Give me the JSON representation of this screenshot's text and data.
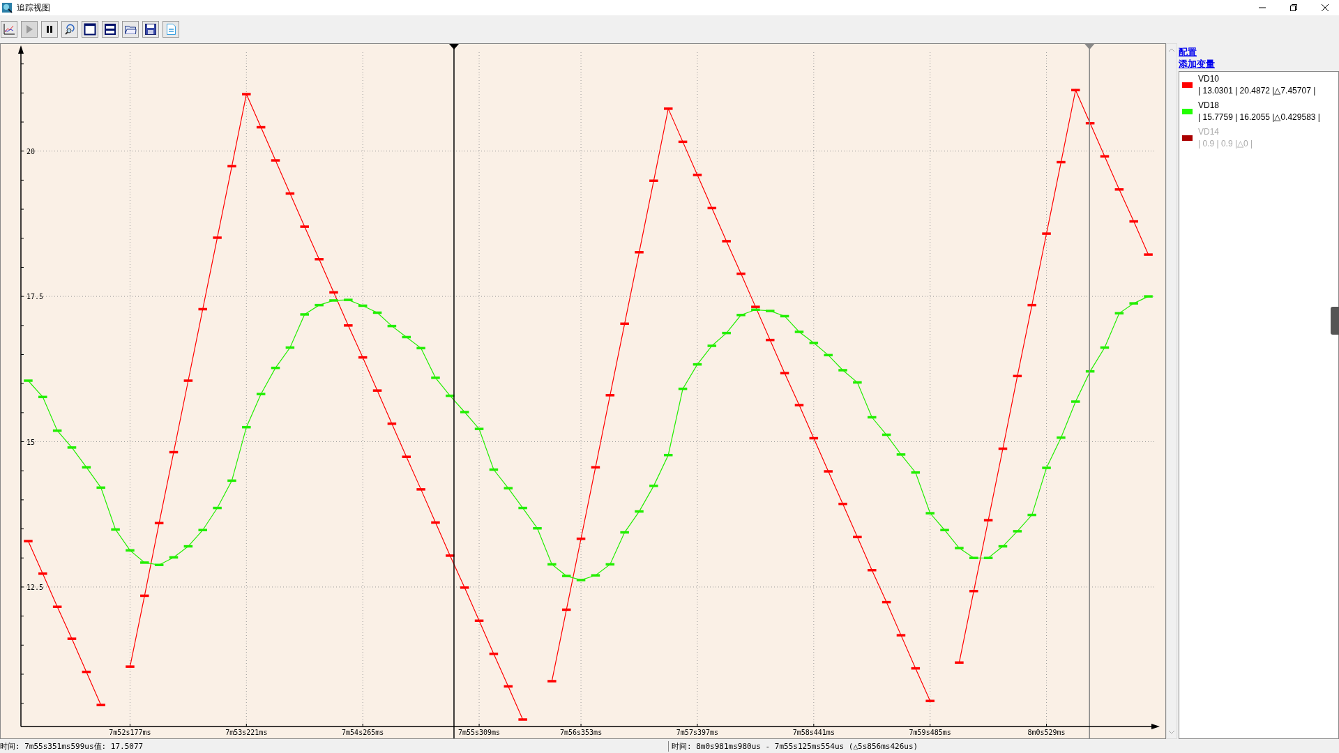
{
  "window": {
    "title": "追踪视图"
  },
  "toolbar": [
    {
      "kind": "chart"
    },
    {
      "kind": "play",
      "disabled": true
    },
    {
      "kind": "pause"
    },
    {
      "kind": "zoom"
    },
    {
      "kind": "window"
    },
    {
      "kind": "split"
    },
    {
      "kind": "open"
    },
    {
      "kind": "save"
    },
    {
      "kind": "csv"
    }
  ],
  "chart": {
    "chart_data": {
      "type": "line",
      "categories": [
        null,
        null,
        null,
        null,
        null,
        null,
        null,
        "7m52s177ms",
        null,
        null,
        null,
        null,
        null,
        null,
        null,
        "7m53s221ms",
        null,
        null,
        null,
        null,
        null,
        null,
        null,
        "7m54s265ms",
        null,
        null,
        null,
        null,
        null,
        null,
        null,
        "7m55s309ms",
        null,
        null,
        null,
        null,
        null,
        null,
        "7m56s353ms",
        null,
        null,
        null,
        null,
        null,
        null,
        null,
        "7m57s397ms",
        null,
        null,
        null,
        null,
        null,
        null,
        null,
        "7m58s441ms",
        null,
        null,
        null,
        null,
        null,
        null,
        null,
        "7m59s485ms",
        null,
        null,
        null,
        null,
        null,
        null,
        null,
        "8m0s529ms",
        null,
        null,
        null,
        null,
        null,
        null,
        null
      ],
      "ylim": [
        10.1,
        21.7
      ],
      "grid": true,
      "yticks": [
        {
          "value": 12.5,
          "label": "12.5"
        },
        {
          "value": 15,
          "label": "15"
        },
        {
          "value": 17.5,
          "label": "17.5"
        },
        {
          "value": 20,
          "label": "20"
        }
      ],
      "series": [
        {
          "color": "#ff0000",
          "values": [
            13.29,
            12.73,
            12.16,
            11.61,
            11.04,
            10.47,
            null,
            11.13,
            12.35,
            13.6,
            14.82,
            16.05,
            17.28,
            18.51,
            19.74,
            20.98,
            20.41,
            19.84,
            19.27,
            18.7,
            18.14,
            17.57,
            17.0,
            16.45,
            15.88,
            15.31,
            14.74,
            14.18,
            13.61,
            13.04,
            12.49,
            11.92,
            11.35,
            10.79,
            10.22,
            null,
            10.88,
            12.11,
            13.33,
            14.56,
            15.8,
            17.03,
            18.26,
            19.49,
            20.73,
            20.16,
            19.59,
            19.02,
            18.45,
            17.89,
            17.32,
            16.75,
            16.18,
            15.63,
            15.06,
            14.49,
            13.93,
            13.36,
            12.79,
            12.24,
            11.67,
            11.1,
            10.54,
            null,
            11.2,
            12.43,
            13.65,
            14.88,
            16.13,
            17.35,
            18.58,
            19.81,
            21.05,
            20.48,
            19.91,
            19.34,
            18.79,
            18.22
          ]
        },
        {
          "color": "#22ee00",
          "values": [
            16.05,
            15.77,
            15.19,
            14.9,
            14.56,
            14.21,
            13.49,
            13.13,
            12.92,
            12.88,
            13.01,
            13.2,
            13.48,
            13.86,
            14.33,
            15.25,
            15.82,
            16.27,
            16.62,
            17.19,
            17.35,
            17.43,
            17.44,
            17.34,
            17.22,
            16.99,
            16.8,
            16.61,
            16.1,
            15.79,
            15.51,
            15.22,
            14.52,
            14.2,
            13.86,
            13.51,
            12.89,
            12.69,
            12.62,
            12.7,
            12.89,
            13.44,
            13.8,
            14.24,
            14.77,
            15.91,
            16.33,
            16.65,
            16.87,
            17.18,
            17.27,
            17.25,
            17.16,
            16.89,
            16.7,
            16.49,
            16.23,
            16.02,
            15.42,
            15.12,
            14.78,
            14.47,
            13.77,
            13.48,
            13.17,
            13.0,
            13.0,
            13.2,
            13.46,
            13.74,
            14.55,
            15.07,
            15.69,
            16.21,
            16.62,
            17.21,
            17.38,
            17.5
          ]
        }
      ]
    },
    "cursors": [
      {
        "active": true
      },
      {
        "active": false
      }
    ]
  },
  "links": [
    "配置",
    "添加变量"
  ],
  "legend": [
    {
      "name": "VD10",
      "color": "#ff0000",
      "enabled": true,
      "stats": "| 13.0301 | 20.4872 |△7.45707 |"
    },
    {
      "name": "VD18",
      "color": "#22ff00",
      "enabled": true,
      "stats": "| 15.7759 | 16.2055 |△0.429583 |"
    },
    {
      "name": "VD14",
      "color": "#aa0000",
      "enabled": false,
      "stats": "| 0.9 | 0.9 |△0 |"
    }
  ],
  "status_bar": [
    "时间: 7m55s351ms599us值: 17.5077",
    "时间: 8m0s981ms980us - 7m55s125ms554us (△5s856ms426us)"
  ]
}
